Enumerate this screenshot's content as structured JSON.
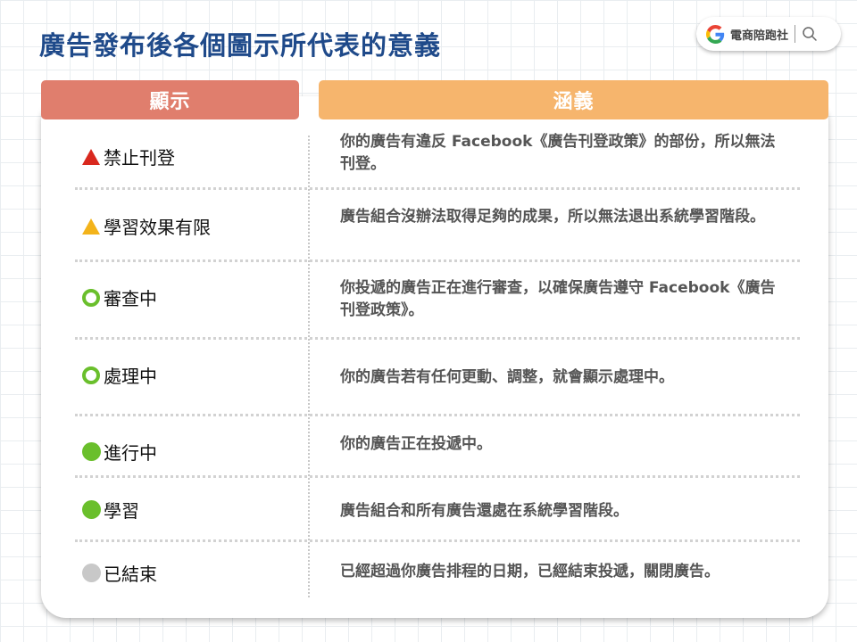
{
  "title": "廣告發布後各個圖示所代表的意義",
  "brand": {
    "name": "電商陪跑社",
    "logo_icon": "google-g-icon",
    "search_icon": "search-icon"
  },
  "headers": {
    "display": "顯示",
    "meaning": "涵義"
  },
  "colors": {
    "header_display": "#e07e6d",
    "header_meaning": "#f6b56d",
    "title": "#1f4a8a",
    "red_triangle": "#d9281e",
    "yellow_triangle": "#f3b31a",
    "green": "#6abf2c",
    "gray": "#c8c8c8"
  },
  "rows": [
    {
      "indicator": "red-triangle-icon",
      "label": "禁止刊登",
      "meaning": "你的廣告有違反 Facebook《廣告刊登政策》的部份，所以無法刊登。"
    },
    {
      "indicator": "yellow-triangle-icon",
      "label": "學習效果有限",
      "meaning": "廣告組合沒辦法取得足夠的成果，所以無法退出系統學習階段。"
    },
    {
      "indicator": "green-ring-icon",
      "label": "審查中",
      "meaning": "你投遞的廣告正在進行審查，以確保廣告遵守 Facebook《廣告刊登政策》。"
    },
    {
      "indicator": "green-ring-icon",
      "label": "處理中",
      "meaning": "你的廣告若有任何更動、調整，就會顯示處理中。"
    },
    {
      "indicator": "green-dot-icon",
      "label": "進行中",
      "meaning": "你的廣告正在投遞中。"
    },
    {
      "indicator": "green-dot-icon",
      "label": "學習",
      "meaning": "廣告組合和所有廣告還處在系統學習階段。"
    },
    {
      "indicator": "gray-dot-icon",
      "label": "已結束",
      "meaning": "已經超過你廣告排程的日期，已經結束投遞，關閉廣告。"
    }
  ]
}
